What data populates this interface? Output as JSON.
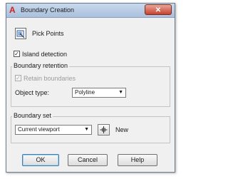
{
  "window": {
    "title": "Boundary Creation",
    "close_glyph": "✕",
    "app_icon": "autocad-a-icon"
  },
  "pick_points": {
    "label": "Pick Points",
    "icon": "pick-points-icon"
  },
  "island_detection": {
    "label": "Island detection",
    "checked": true
  },
  "boundary_retention": {
    "title": "Boundary retention",
    "retain_label": "Retain boundaries",
    "retain_checked": true,
    "retain_enabled": false,
    "object_type_label": "Object type:",
    "object_type_value": "Polyline"
  },
  "boundary_set": {
    "title": "Boundary set",
    "value": "Current viewport",
    "new_label": "New",
    "select_icon": "select-objects-icon"
  },
  "buttons": {
    "ok": "OK",
    "cancel": "Cancel",
    "help": "Help"
  },
  "glyphs": {
    "check": "✓",
    "dropdown": "▼"
  }
}
